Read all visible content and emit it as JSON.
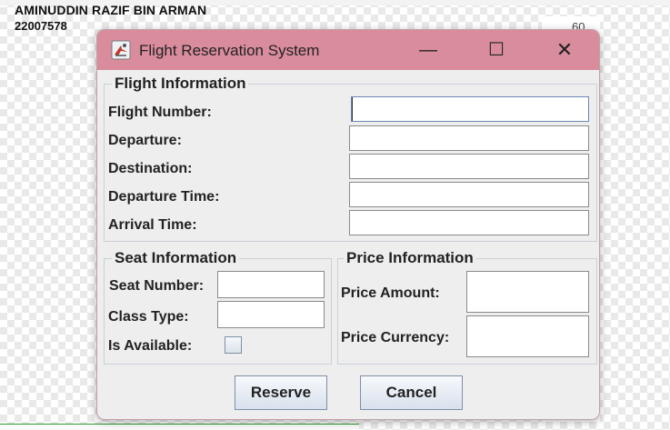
{
  "background": {
    "name": "AMINUDDIN RAZIF BIN ARMAN",
    "id": "22007578",
    "fragment_text": "60"
  },
  "window": {
    "title": "Flight Reservation System",
    "controls": {
      "minimize": "—",
      "maximize": "☐",
      "close": "✕"
    }
  },
  "flight_info": {
    "title": "Flight Information",
    "fields": [
      {
        "label": "Flight Number:",
        "value": ""
      },
      {
        "label": "Departure:",
        "value": ""
      },
      {
        "label": "Destination:",
        "value": ""
      },
      {
        "label": "Departure Time:",
        "value": ""
      },
      {
        "label": "Arrival Time:",
        "value": ""
      }
    ]
  },
  "seat_info": {
    "title": "Seat Information",
    "seat_number_label": "Seat Number:",
    "seat_number_value": "",
    "class_type_label": "Class Type:",
    "class_type_value": "",
    "is_available_label": "Is Available:",
    "is_available_checked": false
  },
  "price_info": {
    "title": "Price Information",
    "amount_label": "Price Amount:",
    "amount_value": "",
    "currency_label": "Price Currency:",
    "currency_value": ""
  },
  "buttons": {
    "reserve": "Reserve",
    "cancel": "Cancel"
  },
  "colors": {
    "titlebar": "#d98c9c",
    "button_top": "#f7f9fc",
    "button_bottom": "#d8e1ed"
  }
}
